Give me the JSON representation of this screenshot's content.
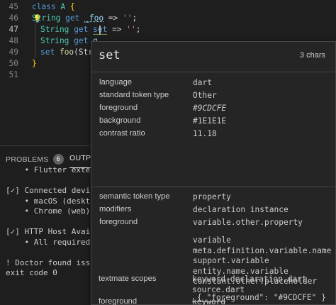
{
  "editor": {
    "lines": [
      {
        "num": "45",
        "tokens": [
          {
            "t": "class ",
            "c": "kw"
          },
          {
            "t": "A",
            "c": "type"
          },
          {
            "t": " {",
            "c": "brace"
          }
        ]
      },
      {
        "num": "46",
        "tokens": [
          {
            "t": "String",
            "c": "type"
          },
          {
            "t": " get ",
            "c": "kw"
          },
          {
            "t": "_foo",
            "c": "ident"
          },
          {
            "t": " => ",
            "c": "plain"
          },
          {
            "t": "''",
            "c": "str"
          },
          {
            "t": ";",
            "c": "plain"
          }
        ]
      },
      {
        "num": "47",
        "tokens": [
          {
            "t": "String",
            "c": "type"
          },
          {
            "t": " get ",
            "c": "kw"
          },
          {
            "t": "set",
            "c": "kw"
          },
          {
            "t": " => ",
            "c": "plain"
          },
          {
            "t": "''",
            "c": "str"
          },
          {
            "t": ";",
            "c": "plain"
          }
        ]
      },
      {
        "num": "48",
        "tokens": [
          {
            "t": "String",
            "c": "type"
          },
          {
            "t": " get ",
            "c": "kw"
          },
          {
            "t": "g",
            "c": "ident"
          }
        ]
      },
      {
        "num": "49",
        "tokens": [
          {
            "t": "set ",
            "c": "kw"
          },
          {
            "t": "foo",
            "c": "fn"
          },
          {
            "t": "(Stri",
            "c": "plain"
          }
        ]
      },
      {
        "num": "50",
        "tokens": [
          {
            "t": "}",
            "c": "brace"
          }
        ]
      },
      {
        "num": "51",
        "tokens": []
      }
    ]
  },
  "panel": {
    "tabs": {
      "problems": "PROBLEMS",
      "problems_count": "6",
      "output": "OUTPU"
    },
    "output_lines": [
      "    • Flutter extens:",
      "",
      "[✓] Connected device",
      "    • macOS (desktop",
      "    • Chrome (web)",
      "",
      "[✓] HTTP Host Availab",
      "    • All required H",
      "",
      "! Doctor found issues",
      "exit code 0"
    ]
  },
  "hover": {
    "title": "set",
    "chars": "3 chars",
    "section1": [
      {
        "label": "language",
        "value": "dart"
      },
      {
        "label": "standard token type",
        "value": "Other"
      },
      {
        "label": "foreground",
        "value": "#9CDCFE"
      },
      {
        "label": "background",
        "value": "#1E1E1E"
      },
      {
        "label": "contrast ratio",
        "value": "11.18"
      }
    ],
    "section2": {
      "semantic_token_type_label": "semantic token type",
      "semantic_token_type": "property",
      "modifiers_label": "modifiers",
      "modifiers": "declaration instance",
      "foreground_label": "foreground",
      "foreground_rule": "variable.other.property",
      "scopes": [
        "variable",
        "meta.definition.variable.name",
        "support.variable",
        "entity.name.variable",
        "constant.other.placeholder"
      ],
      "json": "{ \"foreground\": \"#9CDCFE\" }"
    },
    "section3": {
      "textmate_label": "textmate scopes",
      "textmate_scopes": [
        "keyword.declaration.dart",
        "source.dart"
      ],
      "foreground_label": "foreground",
      "foreground_value": "keyword"
    }
  },
  "colors": {
    "accent_foreground": "#9CDCFE",
    "editor_background": "#1E1E1E"
  }
}
